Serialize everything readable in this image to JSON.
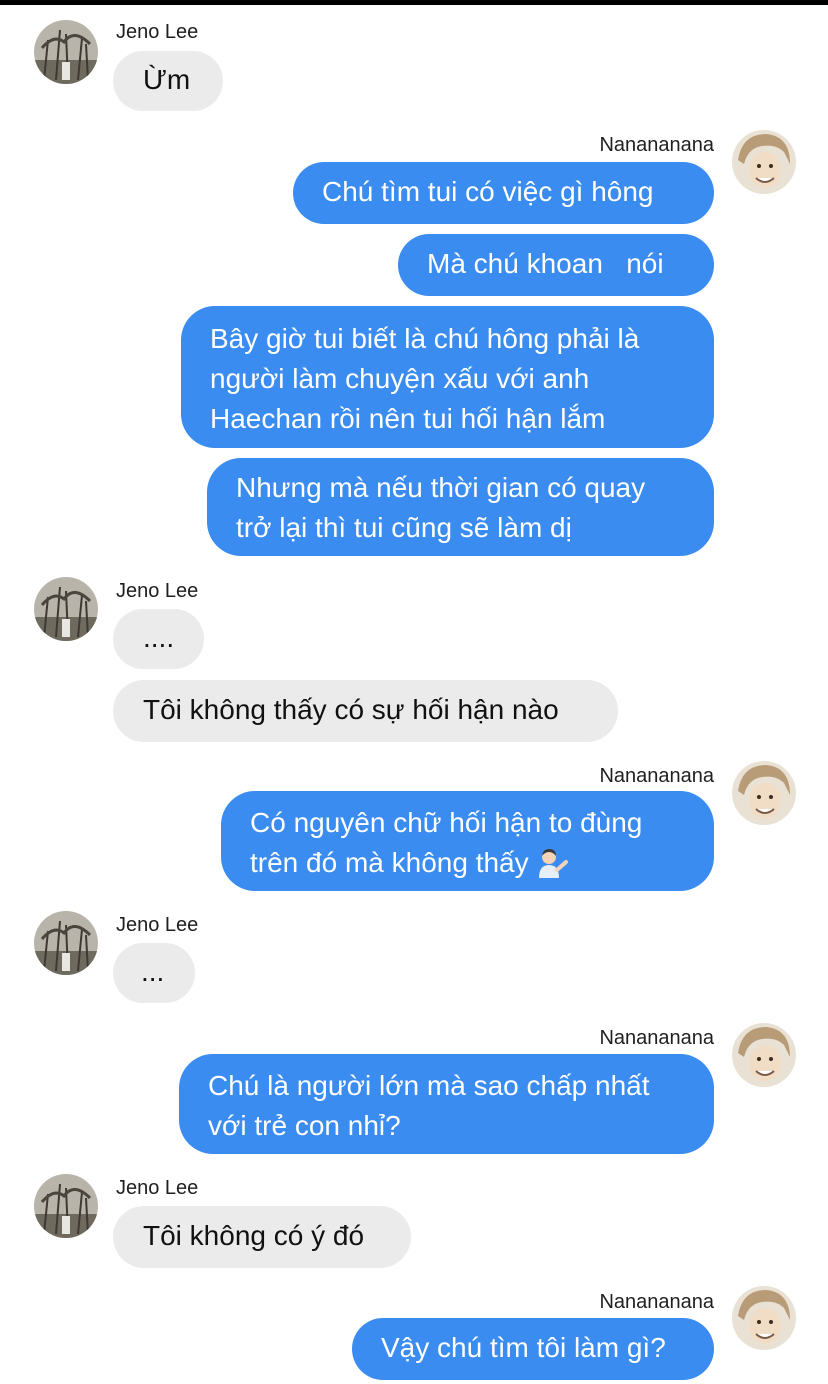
{
  "contacts": {
    "other": {
      "name": "Jeno Lee"
    },
    "me": {
      "name": "Nanananana"
    }
  },
  "messages": [
    {
      "from": "other",
      "sender_name": "Jeno Lee",
      "lines": [
        "Ừm"
      ]
    },
    {
      "from": "me",
      "sender_name": "Nanananana",
      "lines": [
        "Chú tìm tui có việc gì hông"
      ]
    },
    {
      "from": "me",
      "lines": [
        "Mà chú khoan   nói"
      ]
    },
    {
      "from": "me",
      "lines": [
        "Bây giờ tui biết là chú hông phải là",
        "người làm chuyện xấu với anh",
        "Haechan rồi nên tui hối hận lắm"
      ]
    },
    {
      "from": "me",
      "lines": [
        "Nhưng mà nếu thời gian có quay",
        "trở lại thì tui cũng sẽ làm dị"
      ]
    },
    {
      "from": "other",
      "sender_name": "Jeno Lee",
      "lines": [
        "...."
      ]
    },
    {
      "from": "other",
      "lines": [
        "Tôi không thấy có sự hối hận nào"
      ]
    },
    {
      "from": "me",
      "sender_name": "Nanananana",
      "lines": [
        "Có nguyên chữ hối hận to đùng",
        "trên đó mà không thấy"
      ],
      "emoji": "person-tipping-hand-emoji"
    },
    {
      "from": "other",
      "sender_name": "Jeno Lee",
      "lines": [
        "..."
      ]
    },
    {
      "from": "me",
      "sender_name": "Nanananana",
      "lines": [
        "Chú là người lớn mà sao chấp nhất",
        "với trẻ con nhỉ?"
      ]
    },
    {
      "from": "other",
      "sender_name": "Jeno Lee",
      "lines": [
        "Tôi không có ý đó"
      ]
    },
    {
      "from": "me",
      "sender_name": "Nanananana",
      "lines": [
        "Vậy chú tìm tôi làm gì?"
      ]
    }
  ],
  "colors": {
    "outgoing_bubble": "#3b8cf0",
    "incoming_bubble": "#ebebeb",
    "outgoing_text": "#ffffff",
    "incoming_text": "#111111"
  }
}
